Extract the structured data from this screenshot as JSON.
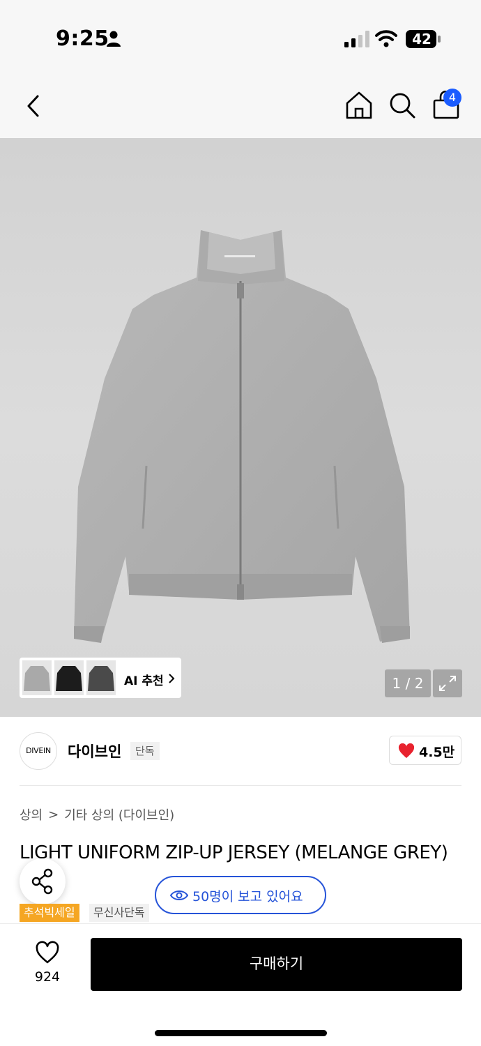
{
  "status_bar": {
    "time": "9:25",
    "battery": "42"
  },
  "nav": {
    "cart_count": "4"
  },
  "gallery": {
    "ai_label": "AI 추천",
    "page_indicator": "1 / 2"
  },
  "brand": {
    "logo_text": "DIVEIN",
    "name": "다이브인",
    "exclusive_tag": "단독",
    "like_count": "4.5만"
  },
  "category": {
    "level1": "상의",
    "separator": ">",
    "level2": "기타 상의 (다이브인)"
  },
  "product": {
    "title": "LIGHT UNIFORM ZIP-UP JERSEY (MELANGE GREY)",
    "viewers": "50명이 보고 있어요",
    "tags": [
      "추석빅세일",
      "무신사단독"
    ]
  },
  "bottom": {
    "wishlist_count": "924",
    "buy_label": "구매하기"
  },
  "colors": {
    "accent_blue": "#2553d8",
    "badge_blue": "#1a5cff",
    "sale_orange": "#f5a623",
    "heart_red": "#e8222e"
  }
}
